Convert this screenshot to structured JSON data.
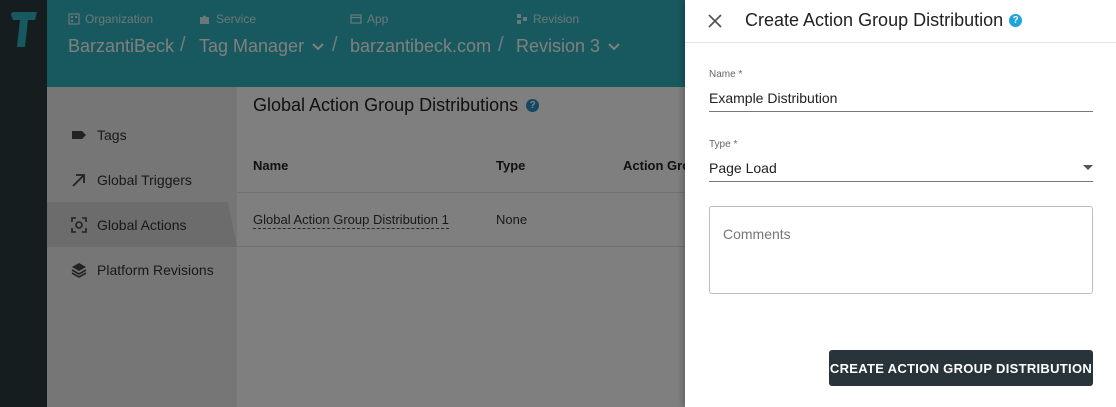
{
  "header": {
    "breadcrumbs": [
      {
        "label": "Organization",
        "value": "BarzantiBeck",
        "has_dropdown": false
      },
      {
        "label": "Service",
        "value": "Tag Manager",
        "has_dropdown": true
      },
      {
        "label": "App",
        "value": "barzantibeck.com",
        "has_dropdown": false
      },
      {
        "label": "Revision",
        "value": "Revision 3",
        "has_dropdown": true
      }
    ],
    "separator": "/"
  },
  "sidebar": {
    "items": [
      {
        "label": "Tags",
        "icon": "tag-icon",
        "active": false
      },
      {
        "label": "Global Triggers",
        "icon": "arrow-up-right-icon",
        "active": false
      },
      {
        "label": "Global Actions",
        "icon": "focus-target-icon",
        "active": true
      },
      {
        "label": "Platform Revisions",
        "icon": "layers-icon",
        "active": false
      }
    ]
  },
  "main": {
    "title": "Global Action Group Distributions",
    "help": "?",
    "columns": [
      "Name",
      "Type",
      "Action Gro"
    ],
    "rows": [
      {
        "name": "Global Action Group Distribution 1",
        "type": "None"
      }
    ]
  },
  "drawer": {
    "title": "Create Action Group Distribution",
    "help": "?",
    "name_label": "Name *",
    "name_value": "Example Distribution",
    "type_label": "Type *",
    "type_value": "Page Load",
    "comments_placeholder": "Comments",
    "submit_label": "CREATE ACTION GROUP DISTRIBUTION"
  },
  "colors": {
    "header": "#2fb3bc",
    "rail": "#2b3a3e",
    "button": "#283439",
    "help": "#2a8fc9"
  }
}
